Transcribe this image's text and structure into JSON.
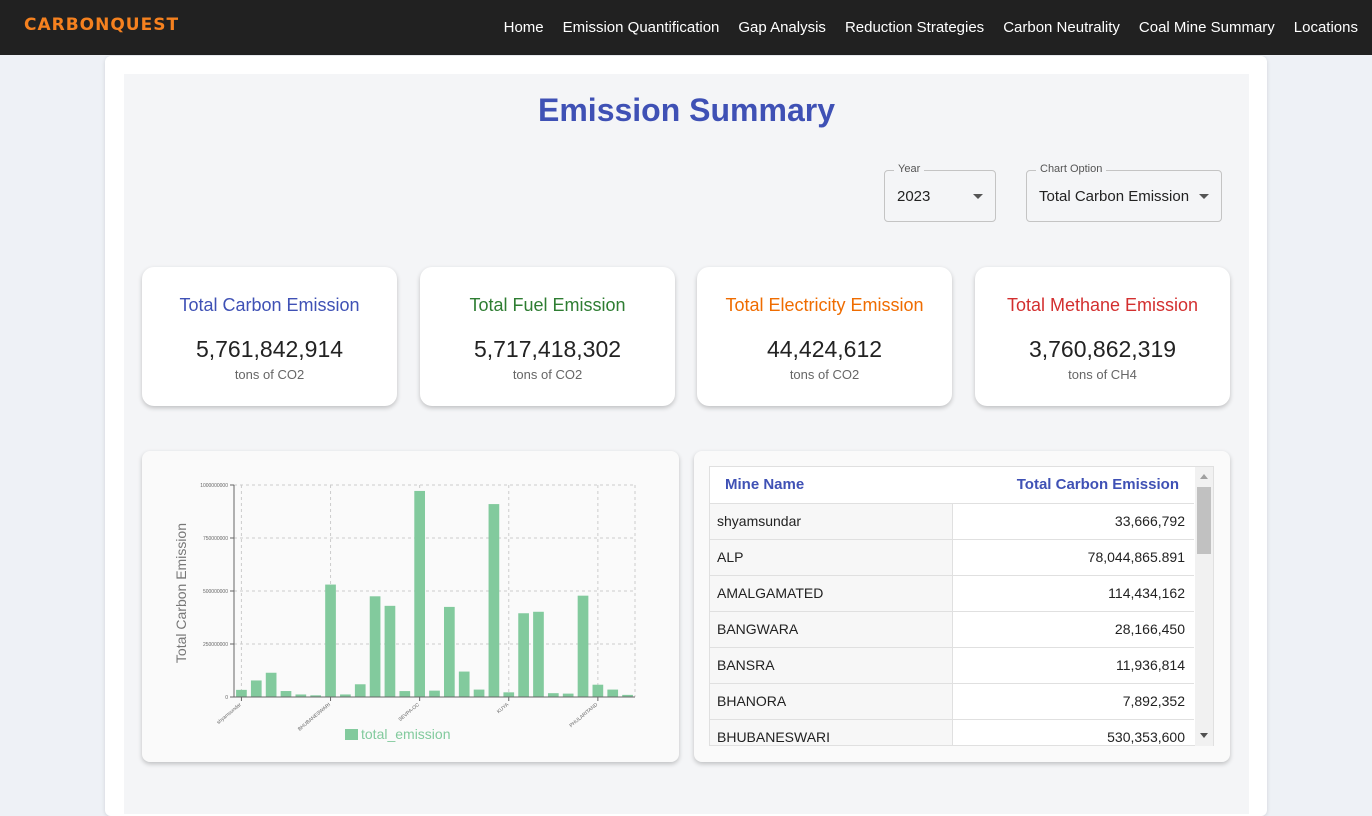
{
  "app": {
    "logo": "CARBONQUEST"
  },
  "nav": {
    "items": [
      "Home",
      "Emission Quantification",
      "Gap Analysis",
      "Reduction Strategies",
      "Carbon Neutrality",
      "Coal Mine Summary",
      "Locations"
    ]
  },
  "page": {
    "title": "Emission Summary"
  },
  "filters": {
    "year": {
      "label": "Year",
      "value": "2023"
    },
    "chart_option": {
      "label": "Chart Option",
      "value": "Total Carbon Emission"
    }
  },
  "cards": [
    {
      "title": "Total Carbon Emission",
      "value": "5,761,842,914",
      "unit": "tons of CO2",
      "color": "#3f51b5"
    },
    {
      "title": "Total Fuel Emission",
      "value": "5,717,418,302",
      "unit": "tons of CO2",
      "color": "#2e7d32"
    },
    {
      "title": "Total Electricity Emission",
      "value": "44,424,612",
      "unit": "tons of CO2",
      "color": "#ef6c00"
    },
    {
      "title": "Total Methane Emission",
      "value": "3,760,862,319",
      "unit": "tons of CH4",
      "color": "#d32f2f"
    }
  ],
  "chart_data": {
    "type": "bar",
    "ylabel": "Total Carbon Emission",
    "ylim": [
      0,
      1000000000
    ],
    "yticks": [
      "0",
      "250000000",
      "500000000",
      "750000000",
      "1000000000"
    ],
    "xtick_labels": [
      "shyamsundar",
      "BHUBANESWARI",
      "SEVPA-OC",
      "KUYA",
      "PHULARITAND"
    ],
    "grid": true,
    "legend": "bottom",
    "series": [
      {
        "name": "total_emission",
        "color": "#82ca9d",
        "values": [
          33666792,
          78044865.891,
          114434162,
          28166450,
          11936814,
          7892352,
          530353600,
          12000000,
          60000000,
          475000000,
          430000000,
          28000000,
          972000000,
          30000000,
          425000000,
          120000000,
          35000000,
          910000000,
          22000000,
          395000000,
          402000000,
          18000000,
          16000000,
          478000000,
          58000000,
          35000000,
          10000000
        ]
      }
    ]
  },
  "table": {
    "headers": [
      "Mine Name",
      "Total Carbon Emission"
    ],
    "rows": [
      [
        "shyamsundar",
        "33,666,792"
      ],
      [
        "ALP",
        "78,044,865.891"
      ],
      [
        "AMALGAMATED",
        "114,434,162"
      ],
      [
        "BANGWARA",
        "28,166,450"
      ],
      [
        "BANSRA",
        "11,936,814"
      ],
      [
        "BHANORA",
        "7,892,352"
      ],
      [
        "BHUBANESWARI",
        "530,353,600"
      ]
    ]
  }
}
